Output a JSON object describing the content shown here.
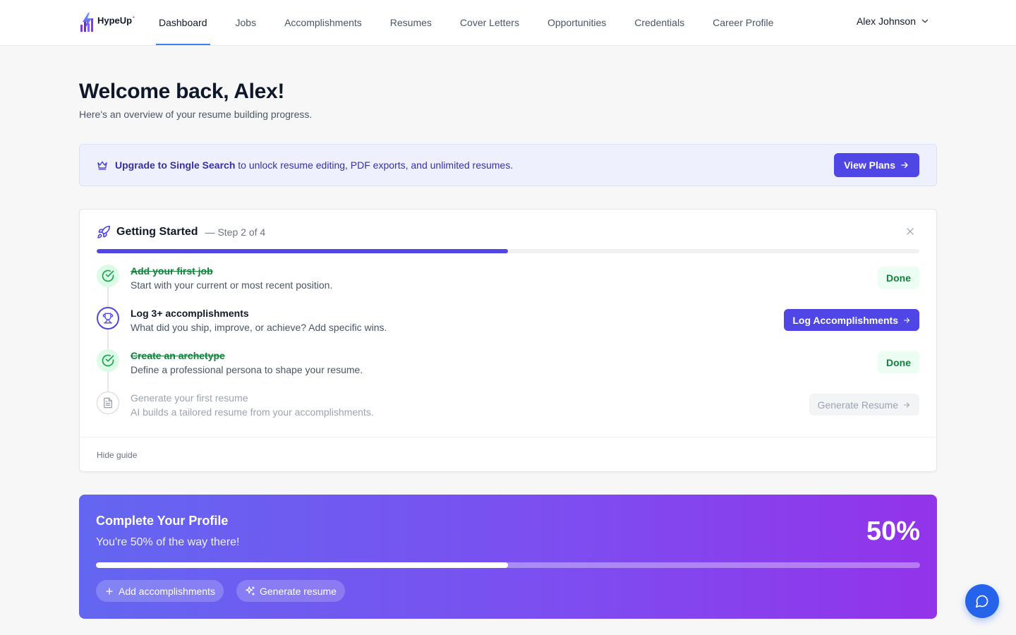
{
  "brand": {
    "name": "HypeUp",
    "mark": "⁺"
  },
  "nav": {
    "items": [
      {
        "label": "Dashboard",
        "active": true
      },
      {
        "label": "Jobs"
      },
      {
        "label": "Accomplishments"
      },
      {
        "label": "Resumes"
      },
      {
        "label": "Cover Letters"
      },
      {
        "label": "Opportunities"
      },
      {
        "label": "Credentials"
      },
      {
        "label": "Career Profile"
      }
    ],
    "user_name": "Alex Johnson"
  },
  "header": {
    "title": "Welcome back, Alex!",
    "subtitle": "Here's an overview of your resume building progress."
  },
  "upgrade": {
    "strong": "Upgrade to Single Search",
    "text": " to unlock resume editing, PDF exports, and unlimited resumes.",
    "button": "View Plans"
  },
  "getting_started": {
    "title": "Getting Started",
    "step_label": "— Step 2 of 4",
    "progress": 0.5,
    "steps": [
      {
        "title": "Add your first job",
        "desc": "Start with your current or most recent position.",
        "status": "done",
        "action": "Done"
      },
      {
        "title": "Log 3+ accomplishments",
        "desc": "What did you ship, improve, or achieve? Add specific wins.",
        "status": "current",
        "action": "Log Accomplishments"
      },
      {
        "title": "Create an archetype",
        "desc": "Define a professional persona to shape your resume.",
        "status": "done",
        "action": "Done"
      },
      {
        "title": "Generate your first resume",
        "desc": "AI builds a tailored resume from your accomplishments.",
        "status": "locked",
        "action": "Generate Resume"
      }
    ],
    "hide_label": "Hide guide"
  },
  "profile": {
    "title": "Complete Your Profile",
    "subtitle": "You're 50% of the way there!",
    "percent_label": "50%",
    "progress": 0.5,
    "actions": [
      "Add accomplishments",
      "Generate resume"
    ]
  },
  "colors": {
    "primary": "#4f46e5",
    "success": "#15803d",
    "gradient_start": "#6366f1",
    "gradient_end": "#9333ea",
    "chat": "#2563eb"
  },
  "icons": [
    "bolt-logo-icon",
    "chevron-down-icon",
    "crown-icon",
    "arrow-right-icon",
    "rocket-icon",
    "close-icon",
    "check-circle-icon",
    "trophy-icon",
    "document-icon",
    "plus-icon",
    "sparkles-icon",
    "chat-icon"
  ]
}
